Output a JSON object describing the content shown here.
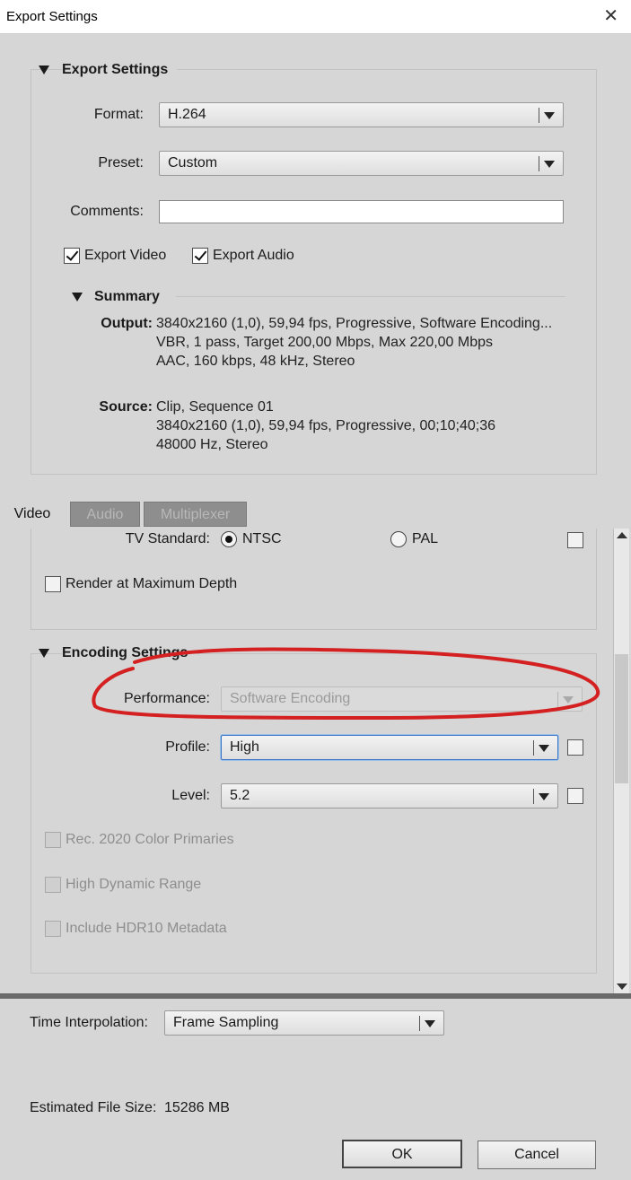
{
  "window": {
    "title": "Export Settings",
    "close_glyph": "✕"
  },
  "export_settings": {
    "heading": "Export Settings",
    "format": {
      "label": "Format:",
      "value": "H.264"
    },
    "preset": {
      "label": "Preset:",
      "value": "Custom"
    },
    "comments": {
      "label": "Comments:",
      "value": ""
    },
    "export_video": {
      "label": "Export Video",
      "checked": true
    },
    "export_audio": {
      "label": "Export Audio",
      "checked": true
    }
  },
  "summary": {
    "heading": "Summary",
    "output_label": "Output:",
    "output_lines": [
      "3840x2160 (1,0), 59,94 fps, Progressive, Software Encoding...",
      "VBR, 1 pass, Target 200,00 Mbps, Max 220,00 Mbps",
      "AAC, 160 kbps, 48 kHz, Stereo"
    ],
    "source_label": "Source:",
    "source_lines": [
      "Clip, Sequence 01",
      "3840x2160 (1,0), 59,94 fps, Progressive, 00;10;40;36",
      "48000 Hz, Stereo"
    ]
  },
  "tabs": [
    {
      "label": "Video",
      "active": true
    },
    {
      "label": "Audio",
      "active": false
    },
    {
      "label": "Multiplexer",
      "active": false
    }
  ],
  "video": {
    "tv_standard": {
      "label": "TV Standard:",
      "options": [
        "NTSC",
        "PAL"
      ],
      "selected": "NTSC"
    },
    "render_max_depth": {
      "label": "Render at Maximum Depth",
      "checked": false
    }
  },
  "encoding_settings": {
    "heading": "Encoding Settings",
    "performance": {
      "label": "Performance:",
      "value": "Software Encoding",
      "disabled": true
    },
    "profile": {
      "label": "Profile:",
      "value": "High"
    },
    "level": {
      "label": "Level:",
      "value": "5.2"
    },
    "rec2020": {
      "label": "Rec. 2020 Color Primaries",
      "disabled": true
    },
    "hdr": {
      "label": "High Dynamic Range",
      "disabled": true
    },
    "hdr10": {
      "label": "Include HDR10 Metadata",
      "disabled": true
    }
  },
  "time_interpolation": {
    "label": "Time Interpolation:",
    "value": "Frame Sampling"
  },
  "estimated_file_size": {
    "label": "Estimated File Size:",
    "value": "15286 MB"
  },
  "buttons": {
    "ok": "OK",
    "cancel": "Cancel"
  },
  "annotation_color": "#d42020"
}
